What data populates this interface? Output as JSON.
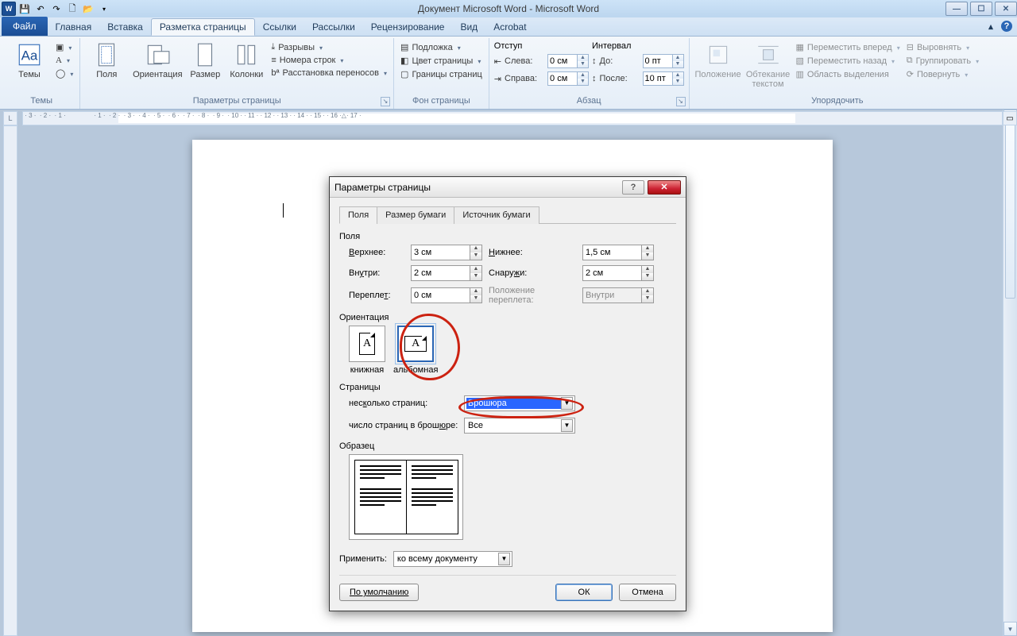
{
  "titlebar": {
    "title": "Документ Microsoft Word  -  Microsoft Word"
  },
  "tabs": {
    "file": "Файл",
    "items": [
      "Главная",
      "Вставка",
      "Разметка страницы",
      "Ссылки",
      "Рассылки",
      "Рецензирование",
      "Вид",
      "Acrobat"
    ],
    "active_index": 2
  },
  "ribbon": {
    "themes": {
      "title": "Темы",
      "main": "Темы"
    },
    "page_setup": {
      "title": "Параметры страницы",
      "margins": "Поля",
      "orientation": "Ориентация",
      "size": "Размер",
      "columns": "Колонки",
      "breaks": "Разрывы",
      "line_numbers": "Номера строк",
      "hyphenation": "Расстановка переносов"
    },
    "page_bg": {
      "title": "Фон страницы",
      "watermark": "Подложка",
      "page_color": "Цвет страницы",
      "borders": "Границы страниц"
    },
    "paragraph": {
      "title": "Абзац",
      "indent_label": "Отступ",
      "spacing_label": "Интервал",
      "left_label": "Слева:",
      "right_label": "Справа:",
      "before_label": "До:",
      "after_label": "После:",
      "left": "0 см",
      "right": "0 см",
      "before": "0 пт",
      "after": "10 пт"
    },
    "arrange": {
      "title": "Упорядочить",
      "position": "Положение",
      "wrap": "Обтекание текстом",
      "bring_forward": "Переместить вперед",
      "send_backward": "Переместить назад",
      "selection_pane": "Область выделения",
      "align": "Выровнять",
      "group": "Группировать",
      "rotate": "Повернуть"
    }
  },
  "dialog": {
    "title": "Параметры страницы",
    "tabs": [
      "Поля",
      "Размер бумаги",
      "Источник бумаги"
    ],
    "active_tab": 0,
    "margins": {
      "section": "Поля",
      "top_label": "Верхнее:",
      "top": "3 см",
      "bottom_label": "Нижнее:",
      "bottom": "1,5 см",
      "inside_label": "Внутри:",
      "inside": "2 см",
      "outside_label": "Снаружи:",
      "outside": "2 см",
      "gutter_label": "Переплет:",
      "gutter": "0 см",
      "gutter_pos_label": "Положение переплета:",
      "gutter_pos": "Внутри"
    },
    "orientation": {
      "section": "Ориентация",
      "portrait": "книжная",
      "landscape": "альбомная"
    },
    "pages": {
      "section": "Страницы",
      "multiple_label": "несколько страниц:",
      "multiple": "Брошюра",
      "sheets_label": "число страниц в брошюре:",
      "sheets": "Все"
    },
    "preview": {
      "section": "Образец"
    },
    "apply": {
      "label": "Применить:",
      "value": "ко всему документу"
    },
    "buttons": {
      "default": "По умолчанию",
      "ok": "ОК",
      "cancel": "Отмена"
    }
  }
}
